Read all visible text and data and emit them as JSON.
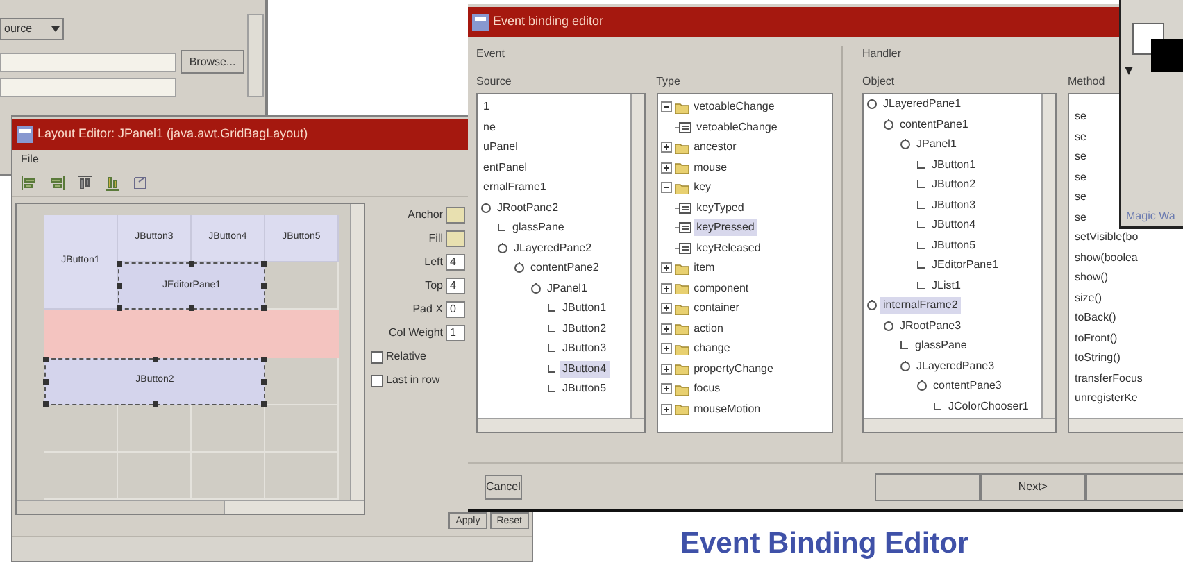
{
  "back_window": {
    "dropdown": {
      "value": "ource"
    },
    "path_button": "Browse..."
  },
  "layout_editor": {
    "title": "Layout Editor: JPanel1 (java.awt.GridBagLayout)",
    "menu": [
      "File"
    ],
    "cells": [
      {
        "label": "JButton1",
        "selected": false
      },
      {
        "label": "JButton3",
        "selected": false
      },
      {
        "label": "JButton4",
        "selected": false
      },
      {
        "label": "JButton5",
        "selected": false
      },
      {
        "label": "JEditorPane1",
        "selected": true
      },
      {
        "label": "JButton2",
        "selected": true
      }
    ],
    "drop_row": {
      "highlighted": true
    },
    "properties": [
      {
        "label": "Anchor",
        "kind": "combo"
      },
      {
        "label": "Fill",
        "kind": "combo"
      },
      {
        "label": "Left",
        "kind": "field",
        "value": "4"
      },
      {
        "label": "Top",
        "kind": "field",
        "value": "4"
      },
      {
        "label": "Pad X",
        "kind": "field",
        "value": "0"
      },
      {
        "label": "Col Weight",
        "kind": "field",
        "value": "1"
      },
      {
        "label": "Relative",
        "kind": "checkbox",
        "checked": false
      },
      {
        "label": "Last in row",
        "kind": "checkbox",
        "checked": false
      }
    ],
    "buttons": [
      "Apply",
      "Reset"
    ]
  },
  "event_editor": {
    "title": "Event binding editor",
    "event": {
      "label": "Event",
      "source": {
        "label": "Source",
        "tree": [
          {
            "label": "1",
            "selected": false
          },
          {
            "label": "ne",
            "selected": false
          },
          {
            "label": "uPanel",
            "selected": false
          },
          {
            "label": "entPanel",
            "selected": false
          },
          {
            "label": "ernalFrame1",
            "selected": false
          },
          {
            "label": "JRootPane2",
            "selected": false,
            "expanded": true,
            "children": [
              {
                "label": "glassPane",
                "selected": false
              },
              {
                "label": "JLayeredPane2",
                "selected": false,
                "expanded": true,
                "children": [
                  {
                    "label": "contentPane2",
                    "selected": false,
                    "expanded": true,
                    "children": [
                      {
                        "label": "JPanel1",
                        "selected": false,
                        "expanded": true,
                        "children": [
                          {
                            "label": "JButton1",
                            "selected": false
                          },
                          {
                            "label": "JButton2",
                            "selected": false
                          },
                          {
                            "label": "JButton3",
                            "selected": false
                          },
                          {
                            "label": "JButton4",
                            "selected": true
                          },
                          {
                            "label": "JButton5",
                            "selected": false
                          }
                        ]
                      }
                    ]
                  }
                ]
              }
            ]
          }
        ]
      },
      "type": {
        "label": "Type",
        "tree": [
          {
            "label": "vetoableChange",
            "selected": false,
            "expanded": true,
            "children": [
              {
                "label": "vetoableChange",
                "selected": false
              }
            ]
          },
          {
            "label": "ancestor",
            "selected": false,
            "expanded": false
          },
          {
            "label": "mouse",
            "selected": false,
            "expanded": false
          },
          {
            "label": "key",
            "selected": false,
            "expanded": true,
            "children": [
              {
                "label": "keyTyped",
                "selected": false
              },
              {
                "label": "keyPressed",
                "selected": true
              },
              {
                "label": "keyReleased",
                "selected": false
              }
            ]
          },
          {
            "label": "item",
            "selected": false,
            "expanded": false
          },
          {
            "label": "component",
            "selected": false,
            "expanded": false
          },
          {
            "label": "container",
            "selected": false,
            "expanded": false
          },
          {
            "label": "action",
            "selected": false,
            "expanded": false
          },
          {
            "label": "change",
            "selected": false,
            "expanded": false
          },
          {
            "label": "propertyChange",
            "selected": false,
            "expanded": false
          },
          {
            "label": "focus",
            "selected": false,
            "expanded": false
          },
          {
            "label": "mouseMotion",
            "selected": false,
            "expanded": false
          }
        ]
      }
    },
    "handler": {
      "label": "Handler",
      "object": {
        "label": "Object",
        "tree": [
          {
            "label": "JLayeredPane1",
            "selected": false,
            "expanded": true,
            "children": [
              {
                "label": "contentPane1",
                "selected": false,
                "expanded": true,
                "children": [
                  {
                    "label": "JPanel1",
                    "selected": false,
                    "expanded": true,
                    "children": [
                      {
                        "label": "JButton1",
                        "selected": false
                      },
                      {
                        "label": "JButton2",
                        "selected": false
                      },
                      {
                        "label": "JButton3",
                        "selected": false
                      },
                      {
                        "label": "JButton4",
                        "selected": false
                      },
                      {
                        "label": "JButton5",
                        "selected": false
                      },
                      {
                        "label": "JEditorPane1",
                        "selected": false
                      },
                      {
                        "label": "JList1",
                        "selected": false
                      }
                    ]
                  }
                ]
              }
            ]
          },
          {
            "label": "internalFrame2",
            "selected": true,
            "expanded": true,
            "children": [
              {
                "label": "JRootPane3",
                "selected": false,
                "expanded": true,
                "children": [
                  {
                    "label": "glassPane",
                    "selected": false
                  },
                  {
                    "label": "JLayeredPane3",
                    "selected": false,
                    "expanded": true,
                    "children": [
                      {
                        "label": "contentPane3",
                        "selected": false,
                        "expanded": true,
                        "children": [
                          {
                            "label": "JColorChooser1",
                            "selected": false
                          }
                        ]
                      }
                    ]
                  }
                ]
              }
            ]
          }
        ]
      },
      "method": {
        "label": "Method",
        "items": [
          {
            "label": "se",
            "selected": false
          },
          {
            "label": "se",
            "selected": false
          },
          {
            "label": "se",
            "selected": false
          },
          {
            "label": "se",
            "selected": false
          },
          {
            "label": "se",
            "selected": false
          },
          {
            "label": "se",
            "selected": false
          },
          {
            "label": "setVisible(bo",
            "selected": false
          },
          {
            "label": "show(boolea",
            "selected": false
          },
          {
            "label": "show()",
            "selected": false
          },
          {
            "label": "size()",
            "selected": false
          },
          {
            "label": "toBack()",
            "selected": false
          },
          {
            "label": "toFront()",
            "selected": false
          },
          {
            "label": "toString()",
            "selected": false
          },
          {
            "label": "transferFocus",
            "selected": false
          },
          {
            "label": "unregisterKe",
            "selected": false
          }
        ]
      }
    },
    "cancel_button": "Cancel",
    "nav_buttons": [
      {
        "kind": "blank"
      },
      {
        "kind": "text",
        "label": "Next>"
      },
      {
        "kind": "blank"
      }
    ]
  },
  "tool_panel": {
    "label": "Magic Wa"
  },
  "caption": "Event Binding Editor"
}
